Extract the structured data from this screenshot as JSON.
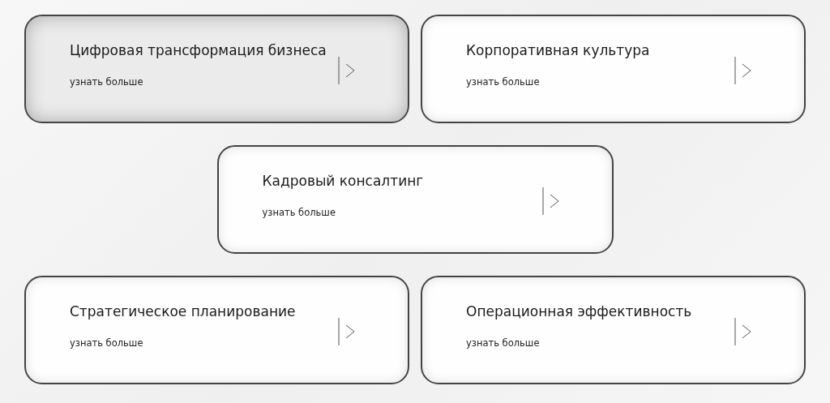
{
  "cards": [
    {
      "title": "Цифровая трансформация бизнеса",
      "link": "узнать больше",
      "selected": true
    },
    {
      "title": "Корпоративная культура",
      "link": "узнать больше",
      "selected": false
    },
    {
      "title": "Кадровый консалтинг",
      "link": "узнать больше",
      "selected": false
    },
    {
      "title": "Стратегическое планирование",
      "link": "узнать больше",
      "selected": false
    },
    {
      "title": "Операционная эффективность",
      "link": "узнать больше",
      "selected": false
    }
  ]
}
